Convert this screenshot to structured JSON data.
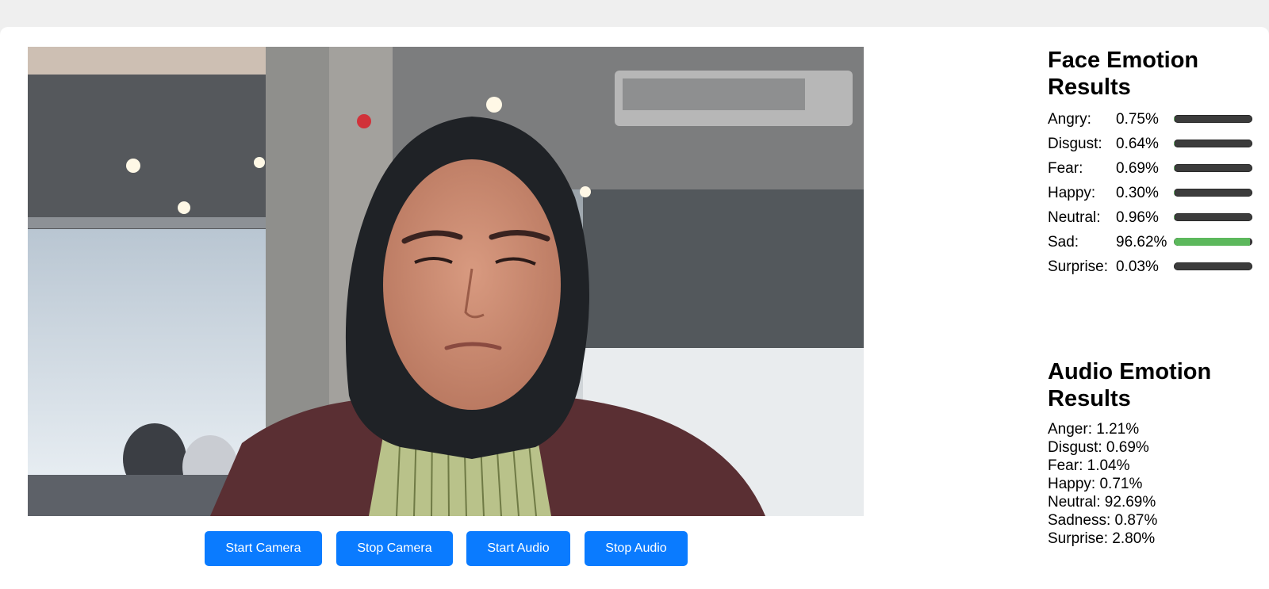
{
  "controls": {
    "start_camera": "Start Camera",
    "stop_camera": "Stop Camera",
    "start_audio": "Start Audio",
    "stop_audio": "Stop Audio"
  },
  "face_panel": {
    "title": "Face Emotion Results",
    "rows": [
      {
        "label": "Angry:",
        "value": "0.75%",
        "level": 0.0075
      },
      {
        "label": "Disgust:",
        "value": "0.64%",
        "level": 0.0064
      },
      {
        "label": "Fear:",
        "value": "0.69%",
        "level": 0.0069
      },
      {
        "label": "Happy:",
        "value": "0.30%",
        "level": 0.003
      },
      {
        "label": "Neutral:",
        "value": "0.96%",
        "level": 0.0096
      },
      {
        "label": "Sad:",
        "value": "96.62%",
        "level": 0.9662
      },
      {
        "label": "Surprise:",
        "value": "0.03%",
        "level": 0.0003
      }
    ]
  },
  "audio_panel": {
    "title": "Audio Emotion Results",
    "lines": [
      "Anger: 1.21%",
      "Disgust: 0.69%",
      "Fear: 1.04%",
      "Happy: 0.71%",
      "Neutral: 92.69%",
      "Sadness: 0.87%",
      "Surprise: 2.80%"
    ]
  },
  "colors": {
    "button": "#0a7bff",
    "bar_fill": "#5cb85c",
    "bar_track": "#3c3c3c",
    "page_bg": "#efefef"
  }
}
